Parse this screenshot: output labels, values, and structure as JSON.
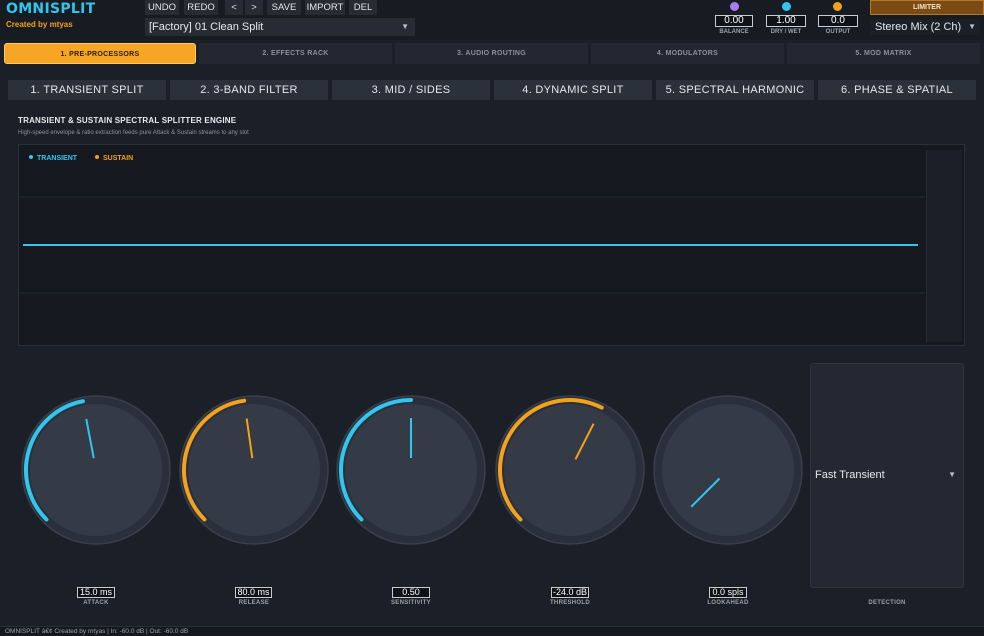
{
  "app": {
    "title": "OMNISPLIT",
    "byline": "Created by mtyas"
  },
  "toolbar": {
    "undo": "UNDO",
    "redo": "REDO",
    "prev": "<",
    "next": ">",
    "save": "SAVE",
    "import": "IMPORT",
    "del": "DEL"
  },
  "preset": {
    "value": "[Factory] 01 Clean Split"
  },
  "mini_controls": [
    {
      "label": "BALANCE",
      "value": "0.00",
      "color": "#a77cf0",
      "icon": "balance-icon"
    },
    {
      "label": "DRY / WET",
      "value": "1.00",
      "color": "#31c6ee",
      "icon": "drywet-icon"
    },
    {
      "label": "OUTPUT",
      "value": "0.0",
      "color": "#f4a11c",
      "icon": "output-icon"
    }
  ],
  "limiter": {
    "label": "LIMITER"
  },
  "output_routing": {
    "value": "Stereo Mix (2 Ch)"
  },
  "main_tabs": [
    {
      "label": "1. PRE-PROCESSORS",
      "active": true
    },
    {
      "label": "2. EFFECTS RACK",
      "active": false
    },
    {
      "label": "3. AUDIO ROUTING",
      "active": false
    },
    {
      "label": "4. MODULATORS",
      "active": false
    },
    {
      "label": "5. MOD MATRIX",
      "active": false
    }
  ],
  "sub_tabs": [
    {
      "label": "1. TRANSIENT SPLIT"
    },
    {
      "label": "2. 3-BAND FILTER"
    },
    {
      "label": "3. MID / SIDES"
    },
    {
      "label": "4. DYNAMIC SPLIT"
    },
    {
      "label": "5. SPECTRAL HARMONIC"
    },
    {
      "label": "6. PHASE & SPATIAL"
    }
  ],
  "section": {
    "title": "TRANSIENT & SUSTAIN SPECTRAL SPLITTER ENGINE",
    "subtitle": "High-speed envelope & ratio extraction feeds pure Attack & Sustain streams to any slot"
  },
  "scope": {
    "legend": [
      {
        "name": "TRANSIENT",
        "color": "#31c6ee"
      },
      {
        "name": "SUSTAIN",
        "color": "#f4a11c"
      }
    ],
    "colors": {
      "transient": "#31c6ee",
      "sustain": "#f4a11c",
      "grid": "#232830"
    }
  },
  "knobs": [
    {
      "label": "ATTACK",
      "display": "15.0 ms",
      "fraction": 0.46,
      "color": "#31c6ee",
      "arc": true
    },
    {
      "label": "RELEASE",
      "display": "80.0 ms",
      "fraction": 0.47,
      "color": "#f4a11c",
      "arc": true
    },
    {
      "label": "SENSITIVITY",
      "display": "0.50",
      "fraction": 0.5,
      "color": "#31c6ee",
      "arc": true
    },
    {
      "label": "THRESHOLD",
      "display": "-24.0 dB",
      "fraction": 0.6,
      "color": "#f4a11c",
      "arc": true
    },
    {
      "label": "LOOKAHEAD",
      "display": "0.0 spls",
      "fraction": 0.0,
      "color": "#31c6ee",
      "arc": false
    }
  ],
  "detection": {
    "label": "DETECTION",
    "value": "Fast Transient"
  },
  "status": {
    "text": "OMNISPLIT â€¢ Created by mtyas  |  In: -60.0 dB  |  Out: -60.0 dB"
  }
}
